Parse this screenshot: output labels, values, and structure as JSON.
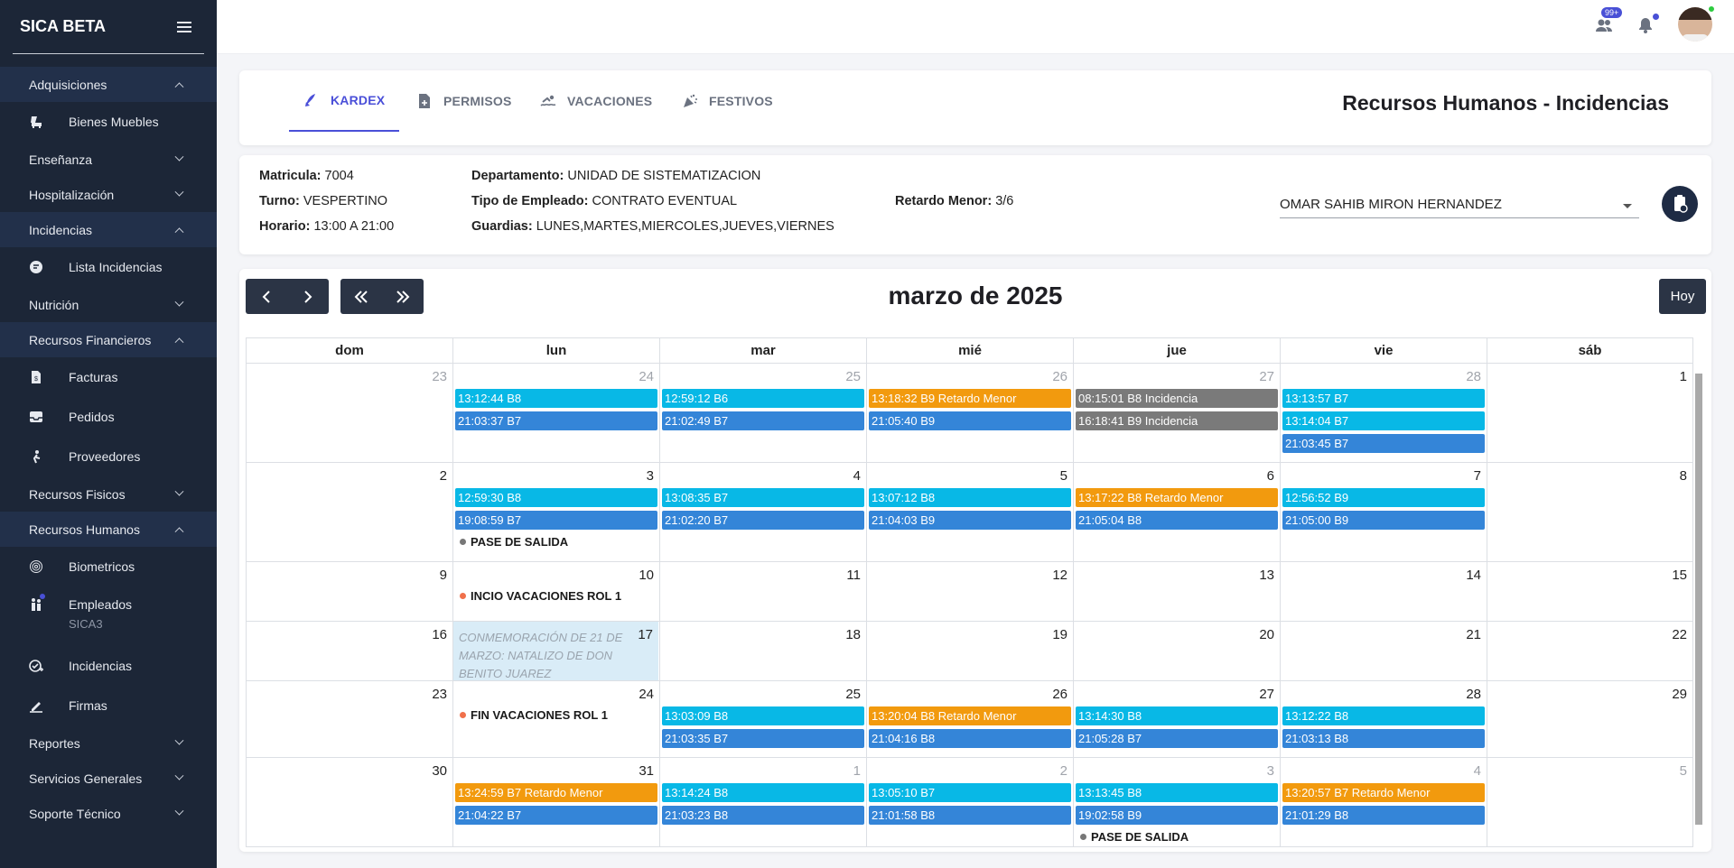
{
  "sidebar": {
    "title": "SICA BETA",
    "sections": [
      {
        "label": "Adquisiciones",
        "open": true,
        "items": [
          {
            "label": "Bienes Muebles",
            "icon": "chair-icon"
          }
        ]
      },
      {
        "label": "Enseñanza",
        "open": false,
        "items": []
      },
      {
        "label": "Hospitalización",
        "open": false,
        "items": []
      },
      {
        "label": "Incidencias",
        "open": true,
        "items": [
          {
            "label": "Lista Incidencias",
            "icon": "list-icon"
          }
        ]
      },
      {
        "label": "Nutrición",
        "open": false,
        "items": []
      },
      {
        "label": "Recursos Financieros",
        "open": true,
        "items": [
          {
            "label": "Facturas",
            "icon": "invoice-icon"
          },
          {
            "label": "Pedidos",
            "icon": "inbox-icon"
          },
          {
            "label": "Proveedores",
            "icon": "hand-truck-icon"
          }
        ]
      },
      {
        "label": "Recursos Fisicos",
        "open": false,
        "items": []
      },
      {
        "label": "Recursos Humanos",
        "open": true,
        "items": [
          {
            "label": "Biometricos",
            "icon": "fingerprint-icon"
          },
          {
            "label": "Empleados",
            "sub": "SICA3",
            "icon": "people-icon"
          },
          {
            "label": "Incidencias",
            "icon": "check-circle-icon"
          },
          {
            "label": "Firmas",
            "icon": "signature-icon"
          }
        ]
      },
      {
        "label": "Reportes",
        "open": false,
        "items": []
      },
      {
        "label": "Servicios Generales",
        "open": false,
        "items": []
      },
      {
        "label": "Soporte Técnico",
        "open": false,
        "items": []
      }
    ]
  },
  "topbar": {
    "badge": "99+",
    "colors": {
      "badge": "#4950d6",
      "online": "#2ecc40",
      "notif_dot": "#4950d6"
    }
  },
  "tabs": [
    {
      "label": "KARDEX",
      "icon": "rocket-icon",
      "active": true
    },
    {
      "label": "PERMISOS",
      "icon": "document-add-icon",
      "active": false
    },
    {
      "label": "VACACIONES",
      "icon": "swimmer-icon",
      "active": false
    },
    {
      "label": "FESTIVOS",
      "icon": "party-popper-icon",
      "active": false
    }
  ],
  "page_title": "Recursos Humanos - Incidencias",
  "employee": {
    "matricula_label": "Matricula:",
    "matricula": "7004",
    "turno_label": "Turno:",
    "turno": "VESPERTINO",
    "horario_label": "Horario:",
    "horario": "13:00 A 21:00",
    "departamento_label": "Departamento:",
    "departamento": "UNIDAD DE SISTEMATIZACION",
    "tipo_label": "Tipo de Empleado:",
    "tipo": "CONTRATO EVENTUAL",
    "guardias_label": "Guardias:",
    "guardias": "LUNES,MARTES,MIERCOLES,JUEVES,VIERNES",
    "retardo_label": "Retardo Menor:",
    "retardo": "3/6",
    "selected_employee": "OMAR SAHIB MIRON HERNANDEZ"
  },
  "calendar": {
    "title": "marzo de 2025",
    "today_label": "Hoy",
    "nav": {
      "prev": "‹",
      "next": "›",
      "prev_year": "«",
      "next_year": "»"
    },
    "weekdays": [
      "dom",
      "lun",
      "mar",
      "mié",
      "jue",
      "vie",
      "sáb"
    ],
    "event_colors": {
      "cyan": "#08b8e6",
      "blue": "#3485d8",
      "orange": "#f29a0e",
      "gray": "#7a7a7a"
    },
    "weeks": [
      {
        "days": [
          {
            "n": "23",
            "other": true,
            "events": []
          },
          {
            "n": "24",
            "other": true,
            "events": [
              {
                "t": "13:12:44 B8",
                "c": "cyan"
              },
              {
                "t": "21:03:37 B7",
                "c": "blue"
              }
            ]
          },
          {
            "n": "25",
            "other": true,
            "events": [
              {
                "t": "12:59:12 B6",
                "c": "cyan"
              },
              {
                "t": "21:02:49 B7",
                "c": "blue"
              }
            ]
          },
          {
            "n": "26",
            "other": true,
            "events": [
              {
                "t": "13:18:32 B9 Retardo Menor",
                "c": "orange"
              },
              {
                "t": "21:05:40 B9",
                "c": "blue"
              }
            ]
          },
          {
            "n": "27",
            "other": true,
            "events": [
              {
                "t": "08:15:01 B8 Incidencia",
                "c": "gray"
              },
              {
                "t": "16:18:41 B9 Incidencia",
                "c": "gray"
              }
            ]
          },
          {
            "n": "28",
            "other": true,
            "events": [
              {
                "t": "13:13:57 B7",
                "c": "cyan"
              },
              {
                "t": "13:14:04 B7",
                "c": "cyan"
              },
              {
                "t": "21:03:45 B7",
                "c": "blue"
              }
            ]
          },
          {
            "n": "1",
            "other": false,
            "events": []
          }
        ]
      },
      {
        "days": [
          {
            "n": "2",
            "other": false,
            "events": []
          },
          {
            "n": "3",
            "other": false,
            "events": [
              {
                "t": "12:59:30 B8",
                "c": "cyan"
              },
              {
                "t": "19:08:59 B7",
                "c": "blue"
              }
            ],
            "labels": [
              {
                "t": "PASE DE SALIDA",
                "dot": "#777777"
              }
            ]
          },
          {
            "n": "4",
            "other": false,
            "events": [
              {
                "t": "13:08:35 B7",
                "c": "cyan"
              },
              {
                "t": "21:02:20 B7",
                "c": "blue"
              }
            ]
          },
          {
            "n": "5",
            "other": false,
            "events": [
              {
                "t": "13:07:12 B8",
                "c": "cyan"
              },
              {
                "t": "21:04:03 B9",
                "c": "blue"
              }
            ]
          },
          {
            "n": "6",
            "other": false,
            "events": [
              {
                "t": "13:17:22 B8 Retardo Menor",
                "c": "orange"
              },
              {
                "t": "21:05:04 B8",
                "c": "blue"
              }
            ]
          },
          {
            "n": "7",
            "other": false,
            "events": [
              {
                "t": "12:56:52 B9",
                "c": "cyan"
              },
              {
                "t": "21:05:00 B9",
                "c": "blue"
              }
            ]
          },
          {
            "n": "8",
            "other": false,
            "events": []
          }
        ]
      },
      {
        "days": [
          {
            "n": "9",
            "other": false,
            "events": []
          },
          {
            "n": "10",
            "other": false,
            "events": [],
            "labels": [
              {
                "t": "INCIO VACACIONES ROL 1",
                "dot": "#f0704b"
              }
            ]
          },
          {
            "n": "11",
            "other": false,
            "events": []
          },
          {
            "n": "12",
            "other": false,
            "events": []
          },
          {
            "n": "13",
            "other": false,
            "events": []
          },
          {
            "n": "14",
            "other": false,
            "events": []
          },
          {
            "n": "15",
            "other": false,
            "events": []
          }
        ]
      },
      {
        "days": [
          {
            "n": "16",
            "other": false,
            "events": []
          },
          {
            "n": "17",
            "other": false,
            "events": [],
            "holiday": "CONMEMORACIÓN DE 21 DE MARZO: NATALIZO DE DON BENITO JUAREZ"
          },
          {
            "n": "18",
            "other": false,
            "events": []
          },
          {
            "n": "19",
            "other": false,
            "events": []
          },
          {
            "n": "20",
            "other": false,
            "events": []
          },
          {
            "n": "21",
            "other": false,
            "events": []
          },
          {
            "n": "22",
            "other": false,
            "events": []
          }
        ]
      },
      {
        "days": [
          {
            "n": "23",
            "other": false,
            "events": []
          },
          {
            "n": "24",
            "other": false,
            "events": [],
            "labels": [
              {
                "t": "FIN VACACIONES ROL 1",
                "dot": "#f0704b"
              }
            ]
          },
          {
            "n": "25",
            "other": false,
            "events": [
              {
                "t": "13:03:09 B8",
                "c": "cyan"
              },
              {
                "t": "21:03:35 B7",
                "c": "blue"
              }
            ]
          },
          {
            "n": "26",
            "other": false,
            "events": [
              {
                "t": "13:20:04 B8 Retardo Menor",
                "c": "orange"
              },
              {
                "t": "21:04:16 B8",
                "c": "blue"
              }
            ]
          },
          {
            "n": "27",
            "other": false,
            "events": [
              {
                "t": "13:14:30 B8",
                "c": "cyan"
              },
              {
                "t": "21:05:28 B7",
                "c": "blue"
              }
            ]
          },
          {
            "n": "28",
            "other": false,
            "events": [
              {
                "t": "13:12:22 B8",
                "c": "cyan"
              },
              {
                "t": "21:03:13 B8",
                "c": "blue"
              }
            ]
          },
          {
            "n": "29",
            "other": false,
            "events": []
          }
        ]
      },
      {
        "days": [
          {
            "n": "30",
            "other": false,
            "events": []
          },
          {
            "n": "31",
            "other": false,
            "events": [
              {
                "t": "13:24:59 B7 Retardo Menor",
                "c": "orange"
              },
              {
                "t": "21:04:22 B7",
                "c": "blue"
              }
            ]
          },
          {
            "n": "1",
            "other": true,
            "events": [
              {
                "t": "13:14:24 B8",
                "c": "cyan"
              },
              {
                "t": "21:03:23 B8",
                "c": "blue"
              }
            ]
          },
          {
            "n": "2",
            "other": true,
            "events": [
              {
                "t": "13:05:10 B7",
                "c": "cyan"
              },
              {
                "t": "21:01:58 B8",
                "c": "blue"
              }
            ]
          },
          {
            "n": "3",
            "other": true,
            "events": [
              {
                "t": "13:13:45 B8",
                "c": "cyan"
              },
              {
                "t": "19:02:58 B9",
                "c": "blue"
              }
            ],
            "labels": [
              {
                "t": "PASE DE SALIDA",
                "dot": "#777777"
              }
            ]
          },
          {
            "n": "4",
            "other": true,
            "events": [
              {
                "t": "13:20:57 B7 Retardo Menor",
                "c": "orange"
              },
              {
                "t": "21:01:29 B8",
                "c": "blue"
              }
            ]
          },
          {
            "n": "5",
            "other": true,
            "events": []
          }
        ]
      }
    ]
  }
}
